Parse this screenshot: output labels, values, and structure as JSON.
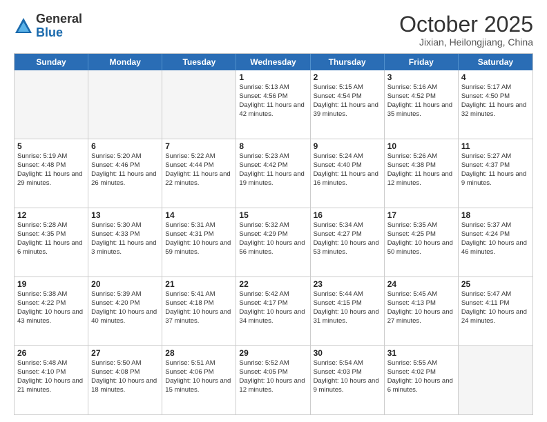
{
  "logo": {
    "general": "General",
    "blue": "Blue"
  },
  "title": "October 2025",
  "location": "Jixian, Heilongjiang, China",
  "weekdays": [
    "Sunday",
    "Monday",
    "Tuesday",
    "Wednesday",
    "Thursday",
    "Friday",
    "Saturday"
  ],
  "weeks": [
    [
      {
        "day": "",
        "empty": true
      },
      {
        "day": "",
        "empty": true
      },
      {
        "day": "",
        "empty": true
      },
      {
        "day": "1",
        "sunrise": "Sunrise: 5:13 AM",
        "sunset": "Sunset: 4:56 PM",
        "daylight": "Daylight: 11 hours and 42 minutes."
      },
      {
        "day": "2",
        "sunrise": "Sunrise: 5:15 AM",
        "sunset": "Sunset: 4:54 PM",
        "daylight": "Daylight: 11 hours and 39 minutes."
      },
      {
        "day": "3",
        "sunrise": "Sunrise: 5:16 AM",
        "sunset": "Sunset: 4:52 PM",
        "daylight": "Daylight: 11 hours and 35 minutes."
      },
      {
        "day": "4",
        "sunrise": "Sunrise: 5:17 AM",
        "sunset": "Sunset: 4:50 PM",
        "daylight": "Daylight: 11 hours and 32 minutes."
      }
    ],
    [
      {
        "day": "5",
        "sunrise": "Sunrise: 5:19 AM",
        "sunset": "Sunset: 4:48 PM",
        "daylight": "Daylight: 11 hours and 29 minutes."
      },
      {
        "day": "6",
        "sunrise": "Sunrise: 5:20 AM",
        "sunset": "Sunset: 4:46 PM",
        "daylight": "Daylight: 11 hours and 26 minutes."
      },
      {
        "day": "7",
        "sunrise": "Sunrise: 5:22 AM",
        "sunset": "Sunset: 4:44 PM",
        "daylight": "Daylight: 11 hours and 22 minutes."
      },
      {
        "day": "8",
        "sunrise": "Sunrise: 5:23 AM",
        "sunset": "Sunset: 4:42 PM",
        "daylight": "Daylight: 11 hours and 19 minutes."
      },
      {
        "day": "9",
        "sunrise": "Sunrise: 5:24 AM",
        "sunset": "Sunset: 4:40 PM",
        "daylight": "Daylight: 11 hours and 16 minutes."
      },
      {
        "day": "10",
        "sunrise": "Sunrise: 5:26 AM",
        "sunset": "Sunset: 4:38 PM",
        "daylight": "Daylight: 11 hours and 12 minutes."
      },
      {
        "day": "11",
        "sunrise": "Sunrise: 5:27 AM",
        "sunset": "Sunset: 4:37 PM",
        "daylight": "Daylight: 11 hours and 9 minutes."
      }
    ],
    [
      {
        "day": "12",
        "sunrise": "Sunrise: 5:28 AM",
        "sunset": "Sunset: 4:35 PM",
        "daylight": "Daylight: 11 hours and 6 minutes."
      },
      {
        "day": "13",
        "sunrise": "Sunrise: 5:30 AM",
        "sunset": "Sunset: 4:33 PM",
        "daylight": "Daylight: 11 hours and 3 minutes."
      },
      {
        "day": "14",
        "sunrise": "Sunrise: 5:31 AM",
        "sunset": "Sunset: 4:31 PM",
        "daylight": "Daylight: 10 hours and 59 minutes."
      },
      {
        "day": "15",
        "sunrise": "Sunrise: 5:32 AM",
        "sunset": "Sunset: 4:29 PM",
        "daylight": "Daylight: 10 hours and 56 minutes."
      },
      {
        "day": "16",
        "sunrise": "Sunrise: 5:34 AM",
        "sunset": "Sunset: 4:27 PM",
        "daylight": "Daylight: 10 hours and 53 minutes."
      },
      {
        "day": "17",
        "sunrise": "Sunrise: 5:35 AM",
        "sunset": "Sunset: 4:25 PM",
        "daylight": "Daylight: 10 hours and 50 minutes."
      },
      {
        "day": "18",
        "sunrise": "Sunrise: 5:37 AM",
        "sunset": "Sunset: 4:24 PM",
        "daylight": "Daylight: 10 hours and 46 minutes."
      }
    ],
    [
      {
        "day": "19",
        "sunrise": "Sunrise: 5:38 AM",
        "sunset": "Sunset: 4:22 PM",
        "daylight": "Daylight: 10 hours and 43 minutes."
      },
      {
        "day": "20",
        "sunrise": "Sunrise: 5:39 AM",
        "sunset": "Sunset: 4:20 PM",
        "daylight": "Daylight: 10 hours and 40 minutes."
      },
      {
        "day": "21",
        "sunrise": "Sunrise: 5:41 AM",
        "sunset": "Sunset: 4:18 PM",
        "daylight": "Daylight: 10 hours and 37 minutes."
      },
      {
        "day": "22",
        "sunrise": "Sunrise: 5:42 AM",
        "sunset": "Sunset: 4:17 PM",
        "daylight": "Daylight: 10 hours and 34 minutes."
      },
      {
        "day": "23",
        "sunrise": "Sunrise: 5:44 AM",
        "sunset": "Sunset: 4:15 PM",
        "daylight": "Daylight: 10 hours and 31 minutes."
      },
      {
        "day": "24",
        "sunrise": "Sunrise: 5:45 AM",
        "sunset": "Sunset: 4:13 PM",
        "daylight": "Daylight: 10 hours and 27 minutes."
      },
      {
        "day": "25",
        "sunrise": "Sunrise: 5:47 AM",
        "sunset": "Sunset: 4:11 PM",
        "daylight": "Daylight: 10 hours and 24 minutes."
      }
    ],
    [
      {
        "day": "26",
        "sunrise": "Sunrise: 5:48 AM",
        "sunset": "Sunset: 4:10 PM",
        "daylight": "Daylight: 10 hours and 21 minutes."
      },
      {
        "day": "27",
        "sunrise": "Sunrise: 5:50 AM",
        "sunset": "Sunset: 4:08 PM",
        "daylight": "Daylight: 10 hours and 18 minutes."
      },
      {
        "day": "28",
        "sunrise": "Sunrise: 5:51 AM",
        "sunset": "Sunset: 4:06 PM",
        "daylight": "Daylight: 10 hours and 15 minutes."
      },
      {
        "day": "29",
        "sunrise": "Sunrise: 5:52 AM",
        "sunset": "Sunset: 4:05 PM",
        "daylight": "Daylight: 10 hours and 12 minutes."
      },
      {
        "day": "30",
        "sunrise": "Sunrise: 5:54 AM",
        "sunset": "Sunset: 4:03 PM",
        "daylight": "Daylight: 10 hours and 9 minutes."
      },
      {
        "day": "31",
        "sunrise": "Sunrise: 5:55 AM",
        "sunset": "Sunset: 4:02 PM",
        "daylight": "Daylight: 10 hours and 6 minutes."
      },
      {
        "day": "",
        "empty": true
      }
    ]
  ]
}
